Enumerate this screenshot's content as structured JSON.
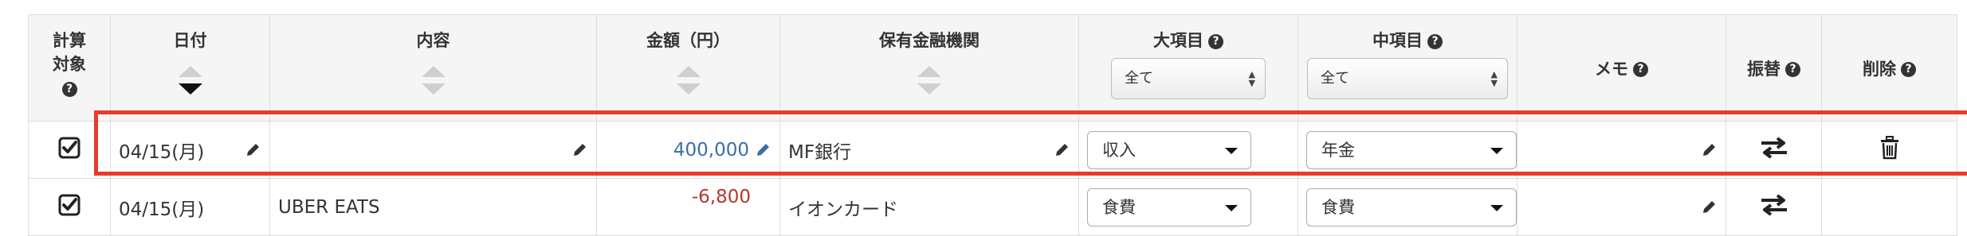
{
  "table": {
    "headers": {
      "calc_target_line1": "計算",
      "calc_target_line2": "対象",
      "date": "日付",
      "content": "内容",
      "amount": "金額（円）",
      "institution": "保有金融機関",
      "major_category": "大項目",
      "minor_category": "中項目",
      "memo": "メモ",
      "transfer": "振替",
      "delete": "削除"
    },
    "filters": {
      "major_selected": "全て",
      "minor_selected": "全て"
    },
    "rows": [
      {
        "date": "04/15(月)",
        "content": "",
        "amount": "400,000",
        "institution": "MF銀行",
        "major": "収入",
        "minor": "年金",
        "memo": ""
      },
      {
        "date": "04/15(月)",
        "content": "UBER EATS",
        "amount": "-6,800",
        "institution": "イオンカード",
        "major": "食費",
        "minor": "食費",
        "memo": ""
      }
    ]
  },
  "icons": {
    "help": "question-circle-icon",
    "edit": "pencil-icon",
    "transfer": "transfer-arrows-icon",
    "delete": "trash-icon",
    "check": "checkbox-checked-icon"
  },
  "colors": {
    "highlight_border": "#e63c2b",
    "positive_amount": "#3a6ea8",
    "negative_amount": "#b23a2e"
  }
}
